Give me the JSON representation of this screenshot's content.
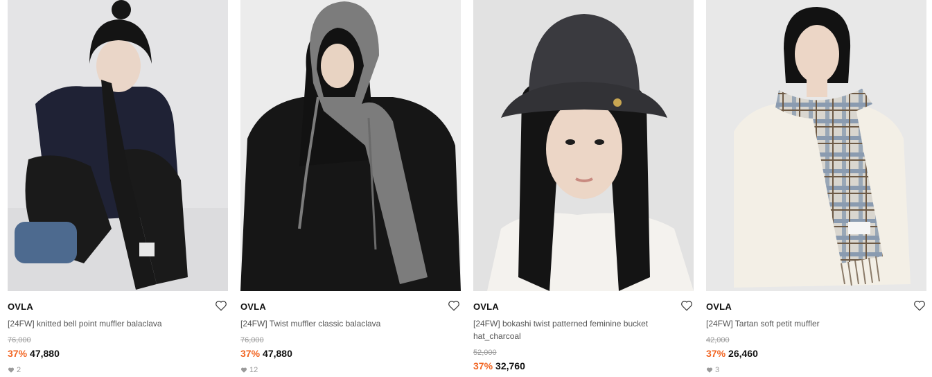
{
  "products": [
    {
      "brand": "OVLA",
      "title": "[24FW] knitted bell point muffler balaclava",
      "original_price": "76,000",
      "discount": "37%",
      "sale_price": "47,880",
      "likes": "2",
      "photo": {
        "bg": "#e6e6e6",
        "accent": "#1c1c1c"
      }
    },
    {
      "brand": "OVLA",
      "title": "[24FW] Twist muffler classic balaclava",
      "original_price": "76,000",
      "discount": "37%",
      "sale_price": "47,880",
      "likes": "12",
      "photo": {
        "bg": "#ececec",
        "accent": "#7a7a7a"
      }
    },
    {
      "brand": "OVLA",
      "title": "[24FW] bokashi twist patterned feminine bucket hat_charcoal",
      "original_price": "52,000",
      "discount": "37%",
      "sale_price": "32,760",
      "likes": "",
      "photo": {
        "bg": "#e3e3e3",
        "accent": "#3a3a3e"
      }
    },
    {
      "brand": "OVLA",
      "title": "[24FW] Tartan soft petit muffler",
      "original_price": "42,000",
      "discount": "37%",
      "sale_price": "26,460",
      "likes": "3",
      "photo": {
        "bg": "#e8e8e8",
        "accent": "#8a9bb0"
      }
    }
  ],
  "colors": {
    "discount": "#f26522",
    "muted": "#9a9a9a",
    "text": "#111111"
  },
  "icons": {
    "wishlist": "heart-outline-icon",
    "likes": "heart-filled-icon"
  }
}
